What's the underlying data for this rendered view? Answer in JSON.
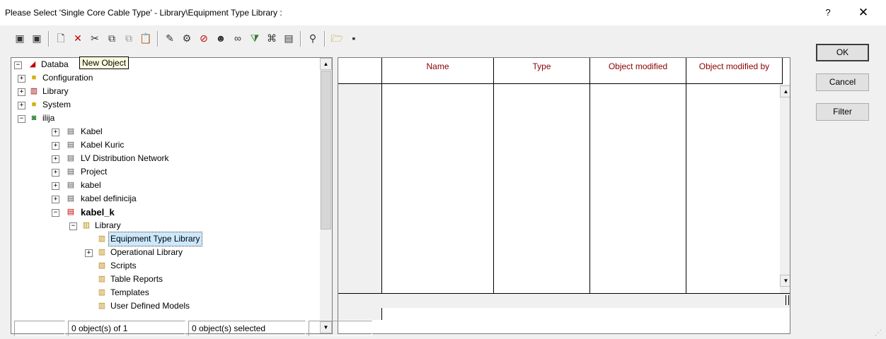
{
  "window": {
    "title": "Please Select 'Single Core Cable Type' - Library\\Equipment Type Library :",
    "help_glyph": "?",
    "close_glyph": "✕"
  },
  "toolbar": {
    "tooltip": "New Object"
  },
  "tree": {
    "root": {
      "label": "Databa"
    },
    "items": [
      {
        "label": "Configuration"
      },
      {
        "label": "Library"
      },
      {
        "label": "System"
      },
      {
        "label": "ilija"
      },
      {
        "label": "Kabel"
      },
      {
        "label": "Kabel Kuric"
      },
      {
        "label": "LV Distribution Network"
      },
      {
        "label": "Project"
      },
      {
        "label": "kabel"
      },
      {
        "label": "kabel definicija"
      },
      {
        "label": "kabel_k"
      },
      {
        "label": "Library"
      },
      {
        "label": "Equipment Type Library"
      },
      {
        "label": "Operational Library"
      },
      {
        "label": "Scripts"
      },
      {
        "label": "Table Reports"
      },
      {
        "label": "Templates"
      },
      {
        "label": "User Defined Models"
      }
    ]
  },
  "grid": {
    "columns": [
      "Name",
      "Type",
      "Object modified",
      "Object modified by"
    ]
  },
  "buttons": {
    "ok": "OK",
    "cancel": "Cancel",
    "filter": "Filter"
  },
  "status": {
    "count": "0 object(s) of 1",
    "selected": "0 object(s) selected"
  }
}
